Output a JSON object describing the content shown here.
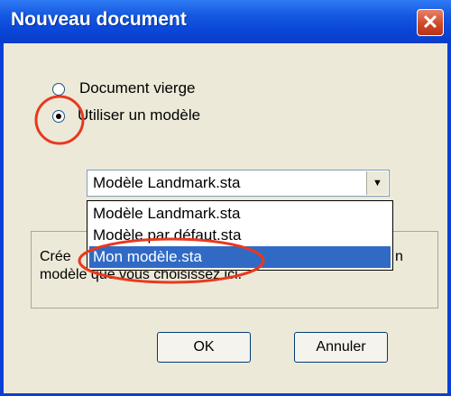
{
  "window": {
    "title": "Nouveau document",
    "close_glyph": "✕"
  },
  "options": {
    "blank": "Document vierge",
    "template": "Utiliser un modèle",
    "selected": "template"
  },
  "template_select": {
    "value": "Modèle Landmark.sta",
    "arrow_glyph": "▼",
    "options": [
      "Modèle Landmark.sta",
      "Modèle par défaut.sta",
      "Mon modèle.sta"
    ],
    "highlighted": "Mon modèle.sta"
  },
  "description": {
    "line1_start": "Crée",
    "line1_end": "n",
    "line2": "modèle que vous choisissez ici."
  },
  "buttons": {
    "ok": "OK",
    "cancel": "Annuler"
  },
  "annotation": {
    "color": "#e8391e"
  }
}
